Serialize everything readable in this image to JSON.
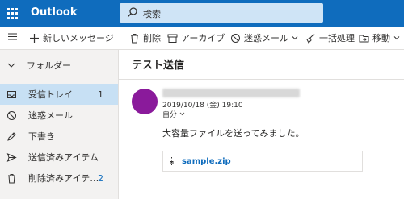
{
  "app": {
    "name": "Outlook"
  },
  "search": {
    "placeholder": "検索"
  },
  "toolbar": {
    "new_message": "新しいメッセージ",
    "delete": "削除",
    "archive": "アーカイブ",
    "junk": "迷惑メール",
    "sweep": "一括処理",
    "move": "移動"
  },
  "sidebar": {
    "header": "フォルダー",
    "items": [
      {
        "label": "受信トレイ",
        "count": "1",
        "icon": "inbox-icon",
        "selected": true
      },
      {
        "label": "迷惑メール",
        "count": "",
        "icon": "blocked-icon",
        "selected": false
      },
      {
        "label": "下書き",
        "count": "",
        "icon": "pencil-icon",
        "selected": false
      },
      {
        "label": "送信済みアイテム",
        "count": "",
        "icon": "send-icon",
        "selected": false
      },
      {
        "label": "削除済みアイテ…",
        "count": "2",
        "icon": "trash-icon",
        "selected": false
      }
    ]
  },
  "message": {
    "subject": "テスト送信",
    "date": "2019/10/18 (金) 19:10",
    "to": "自分",
    "body": "大容量ファイルを送ってみました。",
    "attachment": "sample.zip"
  },
  "colors": {
    "brand": "#0f6cbd",
    "selected": "#c7e0f4",
    "avatar": "#8a1a9b"
  }
}
